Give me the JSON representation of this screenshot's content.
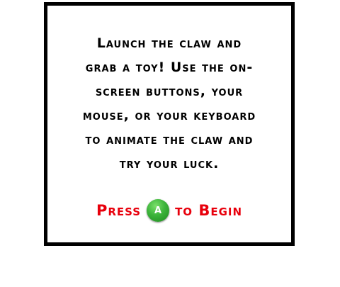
{
  "intro": {
    "lines": [
      "Launch the claw and",
      "grab a toy! Use the on-",
      "screen buttons, your",
      "mouse, or your keyboard",
      "to animate the claw and",
      "try your luck."
    ]
  },
  "start": {
    "press_label": "Press",
    "button_label": "A",
    "to_begin_label": "to Begin"
  },
  "colors": {
    "prompt_red": "#e8000c",
    "button_green": "#3cb33a",
    "border": "#000000"
  }
}
